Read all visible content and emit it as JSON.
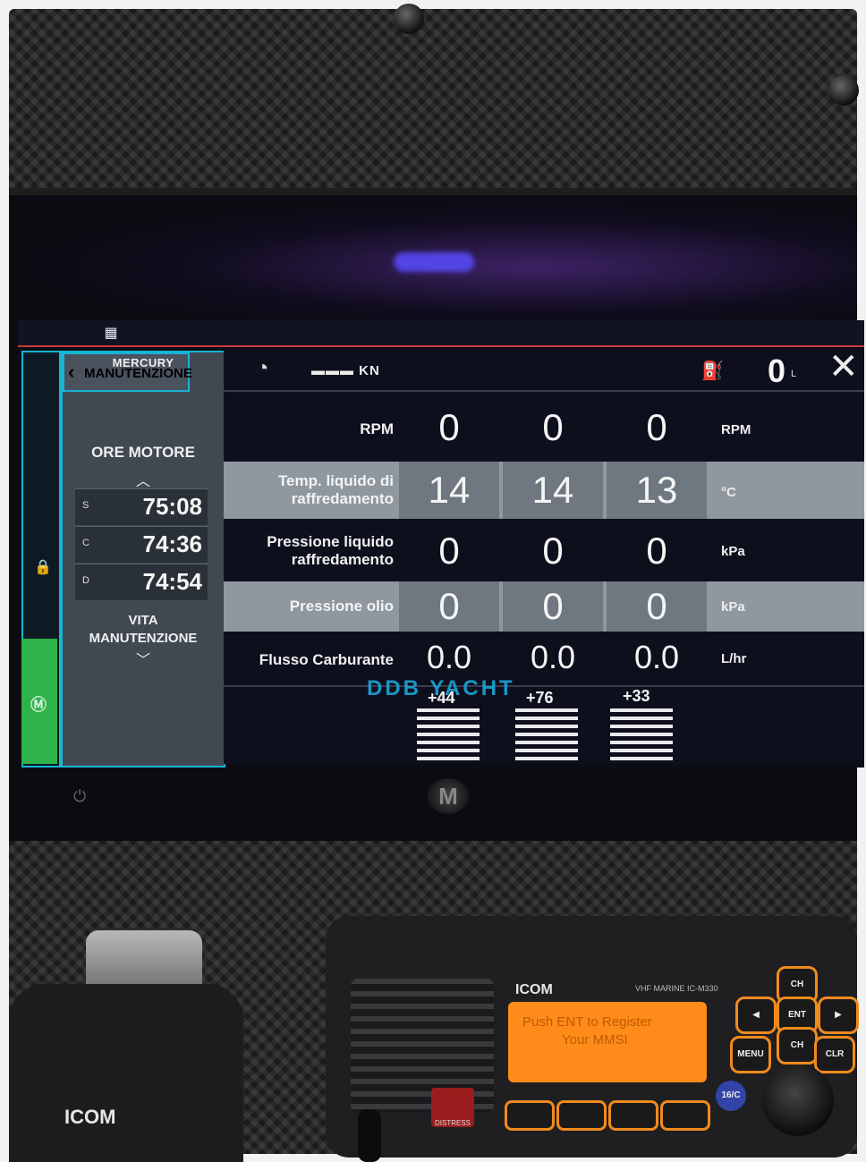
{
  "display": {
    "sidebar": {
      "brand": "MERCURY",
      "back_label": "MANUTENZIONE",
      "hours_title": "ORE MOTORE",
      "hours": [
        {
          "key": "S",
          "value": "75:08"
        },
        {
          "key": "C",
          "value": "74:36"
        },
        {
          "key": "D",
          "value": "74:54"
        }
      ],
      "vita_line1": "VITA",
      "vita_line2": "MANUTENZIONE"
    },
    "header": {
      "speed_value": "▬▬▬ KN",
      "fuel_value": "0",
      "fuel_unit": "L"
    },
    "rows": [
      {
        "label_line1": "RPM",
        "label_line2": "",
        "values": [
          "0",
          "0",
          "0"
        ],
        "unit": "RPM"
      },
      {
        "label_line1": "Temp. liquido di",
        "label_line2": "raffredamento",
        "values": [
          "14",
          "14",
          "13"
        ],
        "unit": "°C"
      },
      {
        "label_line1": "Pressione liquido",
        "label_line2": "raffredamento",
        "values": [
          "0",
          "0",
          "0"
        ],
        "unit": "kPa"
      },
      {
        "label_line1": "Pressione olio",
        "label_line2": "",
        "values": [
          "0",
          "0",
          "0"
        ],
        "unit": "kPa"
      },
      {
        "label_line1": "Flusso Carburante",
        "label_line2": "",
        "values": [
          "0.0",
          "0.0",
          "0.0"
        ],
        "unit": "L/hr"
      }
    ],
    "trim": [
      "+44",
      "+76",
      "+33"
    ],
    "watermark": "DDB YACHT"
  },
  "radio": {
    "brand": "ICOM",
    "model": "VHF MARINE IC-M330",
    "lcd_line1": "Push ENT to Register",
    "lcd_line2": "Your MMSI",
    "keys": {
      "ch_up": "CH",
      "ent": "ENT",
      "menu": "MENU",
      "ch_down": "CH",
      "clr": "CLR",
      "ch16": "16/C",
      "distress": "DISTRESS"
    }
  },
  "mic": {
    "brand": "ICOM"
  },
  "colors": {
    "accent": "#17b4d4",
    "alarm_line": "#c83a3a",
    "status_green": "#2db34a",
    "radio_lcd": "#ff8c1a"
  }
}
